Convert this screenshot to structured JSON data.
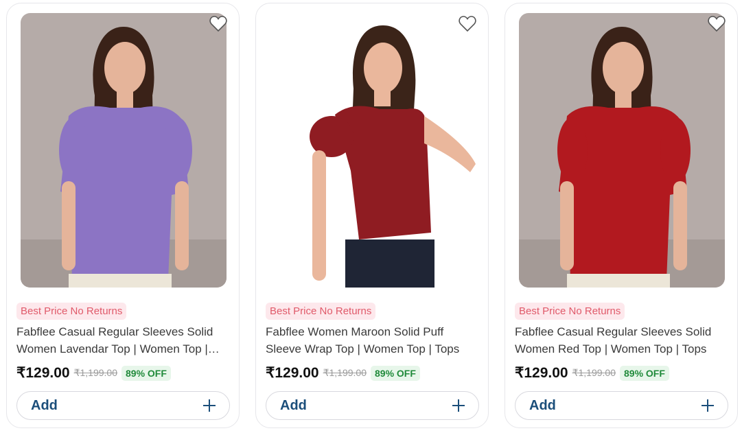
{
  "products": [
    {
      "badge": "Best Price No Returns",
      "title": "Fabflee Casual Regular Sleeves Solid Women Lavendar Top | Women Top | Tops",
      "price": "₹129.00",
      "mrp": "₹1,199.00",
      "discount": "89% OFF",
      "add_label": "Add",
      "top_color": "#8c74c4",
      "image": "woman-lavender-puff-sleeve-top"
    },
    {
      "badge": "Best Price No Returns",
      "title": "Fabflee Women Maroon Solid Puff Sleeve Wrap Top | Women Top | Tops",
      "price": "₹129.00",
      "mrp": "₹1,199.00",
      "discount": "89% OFF",
      "add_label": "Add",
      "top_color": "#8f1c22",
      "image": "woman-maroon-wrap-top"
    },
    {
      "badge": "Best Price No Returns",
      "title": "Fabflee Casual Regular Sleeves Solid Women Red Top | Women Top | Tops",
      "price": "₹129.00",
      "mrp": "₹1,199.00",
      "discount": "89% OFF",
      "add_label": "Add",
      "top_color": "#b2191f",
      "image": "woman-red-puff-sleeve-top"
    }
  ],
  "colors": {
    "badge_bg": "#fde8ec",
    "badge_text": "#e05a6a",
    "discount_bg": "#e7f6ea",
    "discount_text": "#1f8a3a",
    "add_text": "#1b4e7a"
  },
  "icons": {
    "wishlist": "heart-icon",
    "add": "plus-icon"
  }
}
